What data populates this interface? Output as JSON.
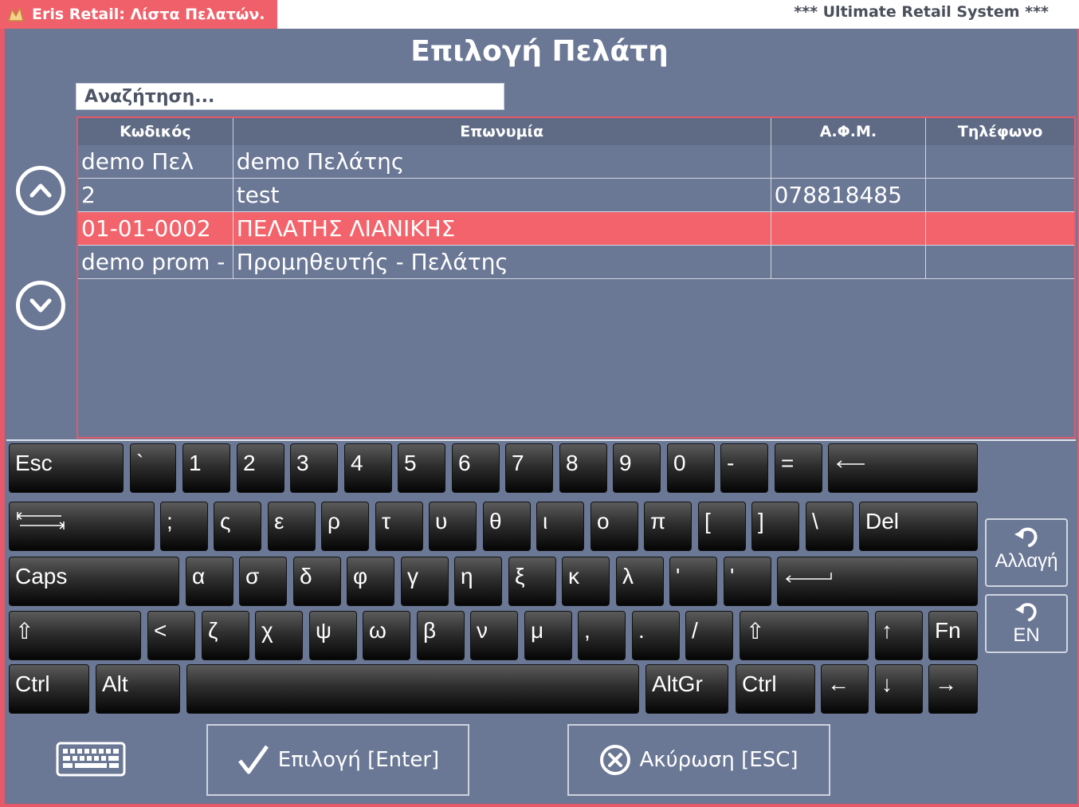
{
  "window": {
    "title": "Eris Retail: Λίστα Πελατών.",
    "tagline": "*** Ultimate Retail System ***"
  },
  "page": {
    "heading": "Επιλογή Πελάτη"
  },
  "search": {
    "placeholder": "Αναζήτηση..."
  },
  "grid": {
    "columns": [
      "Κωδικός",
      "Επωνυμία",
      "Α.Φ.Μ.",
      "Τηλέφωνο"
    ],
    "rows": [
      {
        "code": "demo Πελ",
        "name": "demo Πελάτης",
        "afm": "",
        "phone": ""
      },
      {
        "code": "2",
        "name": "test",
        "afm": "078818485",
        "phone": ""
      },
      {
        "code": "01-01-0002",
        "name": "ΠΕΛΑΤΗΣ ΛΙΑΝΙΚΗΣ",
        "afm": "",
        "phone": "",
        "selected": true
      },
      {
        "code": "demo prom -",
        "name": "Προμηθευτής - Πελάτης",
        "afm": "",
        "phone": ""
      }
    ]
  },
  "nav": {
    "up_icon": "chevron-up-circle-icon",
    "down_icon": "chevron-down-circle-icon"
  },
  "keyboard": {
    "row1": [
      "Esc",
      "`",
      "1",
      "2",
      "3",
      "4",
      "5",
      "6",
      "7",
      "8",
      "9",
      "0",
      "-",
      "=",
      "⟵"
    ],
    "row2": [
      "tab",
      ";",
      "ς",
      "ε",
      "ρ",
      "τ",
      "υ",
      "θ",
      "ι",
      "ο",
      "π",
      "[",
      "]",
      "\\",
      "Del"
    ],
    "row3": [
      "Caps",
      "α",
      "σ",
      "δ",
      "φ",
      "γ",
      "η",
      "ξ",
      "κ",
      "λ",
      "'",
      "'",
      "enter"
    ],
    "row4": [
      "⇧",
      "<",
      "ζ",
      "χ",
      "ψ",
      "ω",
      "β",
      "ν",
      "μ",
      ",",
      ".",
      "/",
      "⇧",
      "↑",
      "Fn"
    ],
    "row5": [
      "Ctrl",
      "Alt",
      "",
      "AltGr",
      "Ctrl",
      "←",
      "↓",
      "→"
    ],
    "switch_label": "Αλλαγή",
    "language_label": "EN"
  },
  "actions": {
    "select_label": "Επιλογή [Enter]",
    "cancel_label": "Ακύρωση [ESC]"
  },
  "colors": {
    "accent": "#f0606a",
    "background": "#6a7795",
    "selected_row": "#f2636b"
  }
}
